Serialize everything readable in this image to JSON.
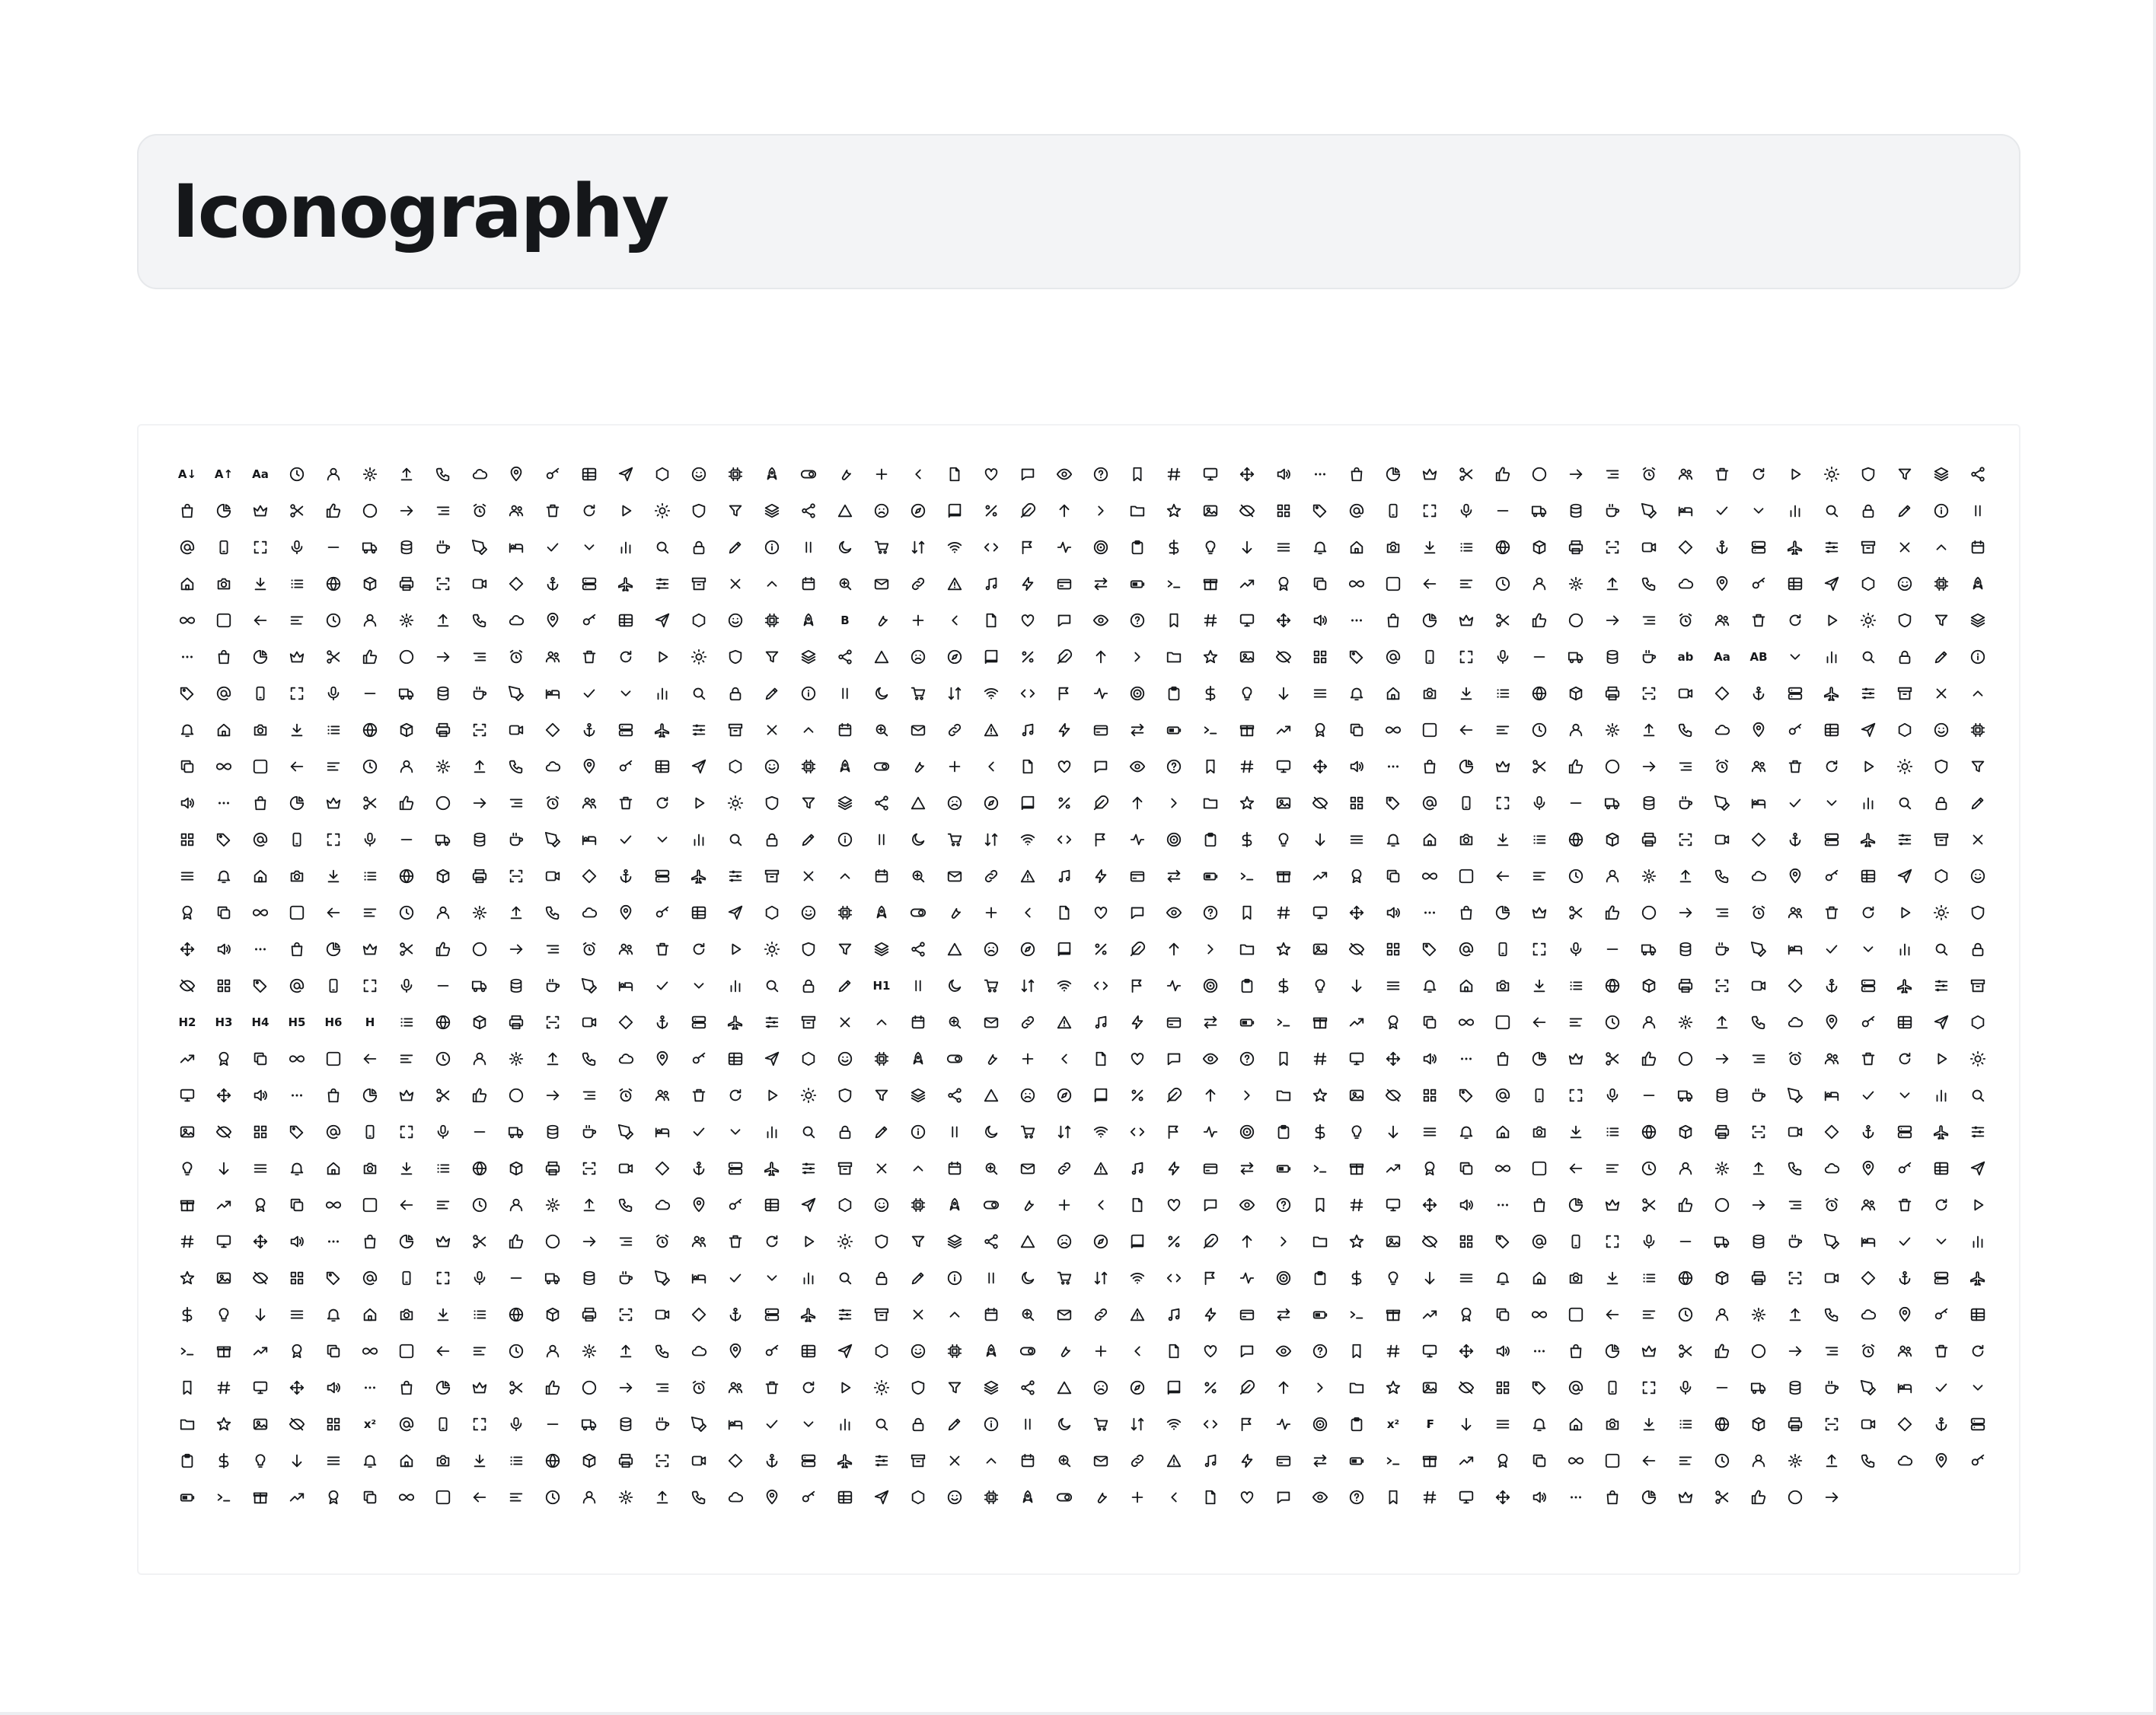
{
  "header": {
    "title": "Iconography"
  },
  "icon_grid": {
    "columns": 50,
    "icon_count": 1446,
    "text_glyphs": [
      {
        "index": 0,
        "text": "A↓"
      },
      {
        "index": 1,
        "text": "A↑"
      },
      {
        "index": 2,
        "text": "Aa"
      },
      {
        "index": 218,
        "text": "B"
      },
      {
        "index": 291,
        "text": "ab"
      },
      {
        "index": 292,
        "text": "Aa"
      },
      {
        "index": 293,
        "text": "AB"
      },
      {
        "index": 719,
        "text": "H1"
      },
      {
        "index": 750,
        "text": "H2"
      },
      {
        "index": 751,
        "text": "H3"
      },
      {
        "index": 752,
        "text": "H4"
      },
      {
        "index": 753,
        "text": "H5"
      },
      {
        "index": 754,
        "text": "H6"
      },
      {
        "index": 755,
        "text": "H"
      },
      {
        "index": 1305,
        "text": "x²"
      },
      {
        "index": 1333,
        "text": "x²"
      },
      {
        "index": 1334,
        "text": "₣"
      }
    ]
  }
}
